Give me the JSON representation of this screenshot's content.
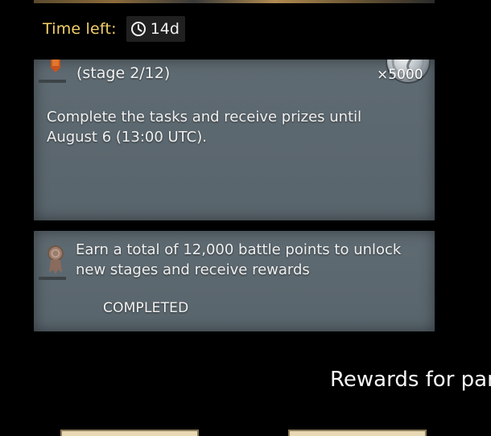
{
  "timer": {
    "label": "Time left:",
    "value": "14d"
  },
  "event_card": {
    "stage_text": "(stage 2/12)",
    "reward_quantity": "×5000",
    "description": "Complete the tasks and receive prizes until August 6 (13:00 UTC)."
  },
  "task_card": {
    "description": "Earn a total of 12,000 battle points to unlock new stages and receive rewards",
    "status": "COMPLETED"
  },
  "rewards": {
    "heading": "Rewards for par"
  },
  "icons": {
    "timer": "clock-icon",
    "event_badge": "ribbon-badge-icon",
    "task_badge": "medal-icon",
    "reward": "silver-coin-icon"
  },
  "colors": {
    "timer_label": "#f3d06a",
    "card_background": "#5f6b72",
    "page_background": "#000000",
    "reward_tile": "#e8d8b4"
  }
}
